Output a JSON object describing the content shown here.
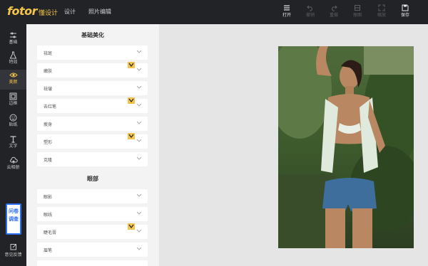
{
  "brand": {
    "logo_text": "fotor",
    "logo_sub": "懂设计",
    "accent_color": "#f3c44d"
  },
  "top_nav": {
    "design": "设计",
    "photo_edit": "照片编辑"
  },
  "toolbar": [
    {
      "label": "打开",
      "icon": "menu-icon",
      "enabled": true
    },
    {
      "label": "撤销",
      "icon": "undo-icon",
      "enabled": false
    },
    {
      "label": "重做",
      "icon": "redo-icon",
      "enabled": false
    },
    {
      "label": "原图",
      "icon": "original-icon",
      "enabled": false
    },
    {
      "label": "缩放",
      "icon": "zoom-icon",
      "enabled": false
    },
    {
      "label": "保存",
      "icon": "save-icon",
      "enabled": true
    }
  ],
  "rail": [
    {
      "label": "基础",
      "icon": "sliders-icon"
    },
    {
      "label": "特效",
      "icon": "flask-icon"
    },
    {
      "label": "美颜",
      "icon": "eye-icon",
      "active": true
    },
    {
      "label": "边框",
      "icon": "frame-icon"
    },
    {
      "label": "贴纸",
      "icon": "sticker-icon"
    },
    {
      "label": "文字",
      "icon": "text-icon"
    },
    {
      "label": "云相册",
      "icon": "cloud-icon"
    }
  ],
  "survey": {
    "line1": "问卷",
    "line2": "调查"
  },
  "feedback": {
    "label": "意见反馈",
    "icon": "edit-icon"
  },
  "panel": {
    "section1_title": "基础美化",
    "section1_items": [
      {
        "label": "祛斑",
        "vip": false
      },
      {
        "label": "嫩肤",
        "vip": true
      },
      {
        "label": "祛皱",
        "vip": false
      },
      {
        "label": "去红笔",
        "vip": true
      },
      {
        "label": "瘦身",
        "vip": false
      },
      {
        "label": "塑形",
        "vip": true
      },
      {
        "label": "克隆",
        "vip": false
      }
    ],
    "section2_title": "眼部",
    "section2_items": [
      {
        "label": "眼影",
        "vip": false
      },
      {
        "label": "眼线",
        "vip": false
      },
      {
        "label": "睫毛膏",
        "vip": true
      },
      {
        "label": "眉笔",
        "vip": false
      }
    ]
  }
}
